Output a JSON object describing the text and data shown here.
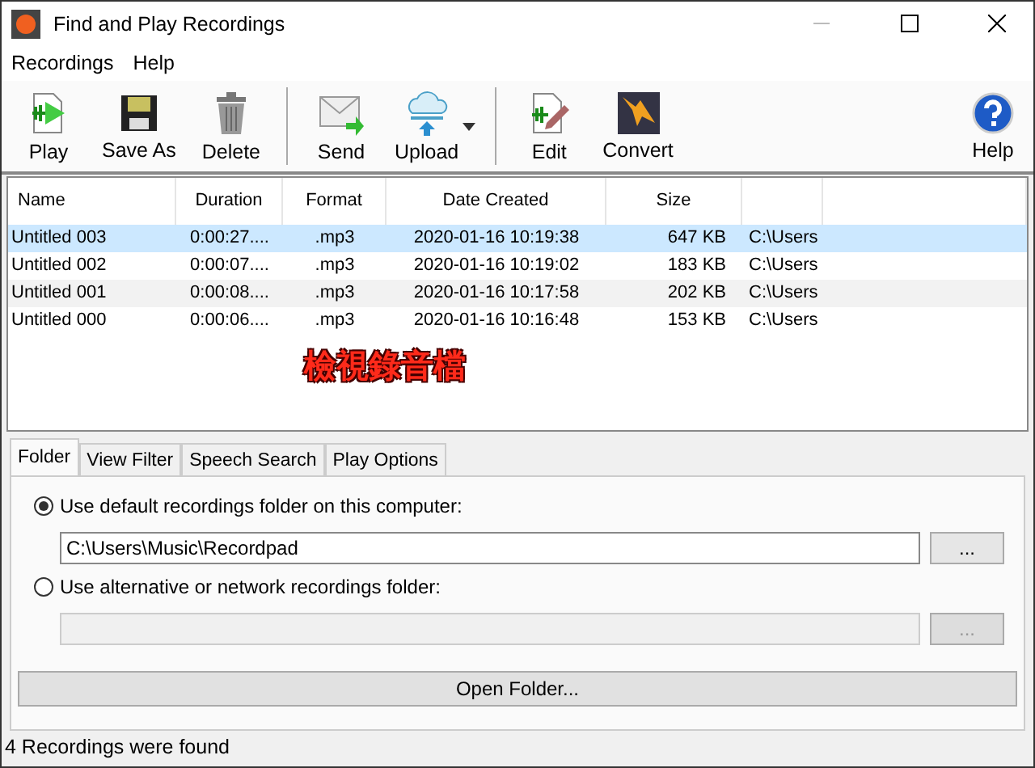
{
  "window": {
    "title": "Find and Play Recordings"
  },
  "menu": [
    "Recordings",
    "Help"
  ],
  "toolbar": [
    {
      "kind": "play",
      "label": "Play"
    },
    {
      "kind": "save",
      "label": "Save As"
    },
    {
      "kind": "delete",
      "label": "Delete"
    },
    {
      "kind": "separator"
    },
    {
      "kind": "send",
      "label": "Send"
    },
    {
      "kind": "upload",
      "label": "Upload",
      "dropdown": true
    },
    {
      "kind": "separator"
    },
    {
      "kind": "edit",
      "label": "Edit"
    },
    {
      "kind": "convert",
      "label": "Convert"
    },
    {
      "kind": "spacer"
    },
    {
      "kind": "help",
      "label": "Help"
    }
  ],
  "table": {
    "columns": [
      "Name",
      "Duration",
      "Format",
      "Date Created",
      "Size"
    ],
    "rows": [
      {
        "cells": [
          "Untitled 003",
          "0:00:27....",
          ".mp3",
          "2020-01-16 10:19:38",
          "647 KB",
          "C:\\Users"
        ],
        "selected": true
      },
      {
        "cells": [
          "Untitled 002",
          "0:00:07....",
          ".mp3",
          "2020-01-16 10:19:02",
          "183 KB",
          "C:\\Users"
        ],
        "selected": false
      },
      {
        "cells": [
          "Untitled 001",
          "0:00:08....",
          ".mp3",
          "2020-01-16 10:17:58",
          "202 KB",
          "C:\\Users"
        ],
        "selected": false
      },
      {
        "cells": [
          "Untitled 000",
          "0:00:06....",
          ".mp3",
          "2020-01-16 10:16:48",
          "153 KB",
          "C:\\Users"
        ],
        "selected": false
      }
    ]
  },
  "annotation": "檢視錄音檔",
  "tabs": [
    {
      "label": "Folder",
      "selected": true
    },
    {
      "label": "View Filter",
      "selected": false
    },
    {
      "label": "Speech Search",
      "selected": false
    },
    {
      "label": "Play Options",
      "selected": false
    }
  ],
  "folder": {
    "options": [
      {
        "label": "Use default recordings folder on this computer:",
        "selected": true,
        "path": "C:\\Users\\Music\\Recordpad",
        "disabled": false,
        "browse": "..."
      },
      {
        "label": "Use alternative or network recordings folder:",
        "selected": false,
        "disabled": true,
        "browse": "..."
      }
    ],
    "open_button": "Open Folder..."
  },
  "status_bar": "4 Recordings were found"
}
